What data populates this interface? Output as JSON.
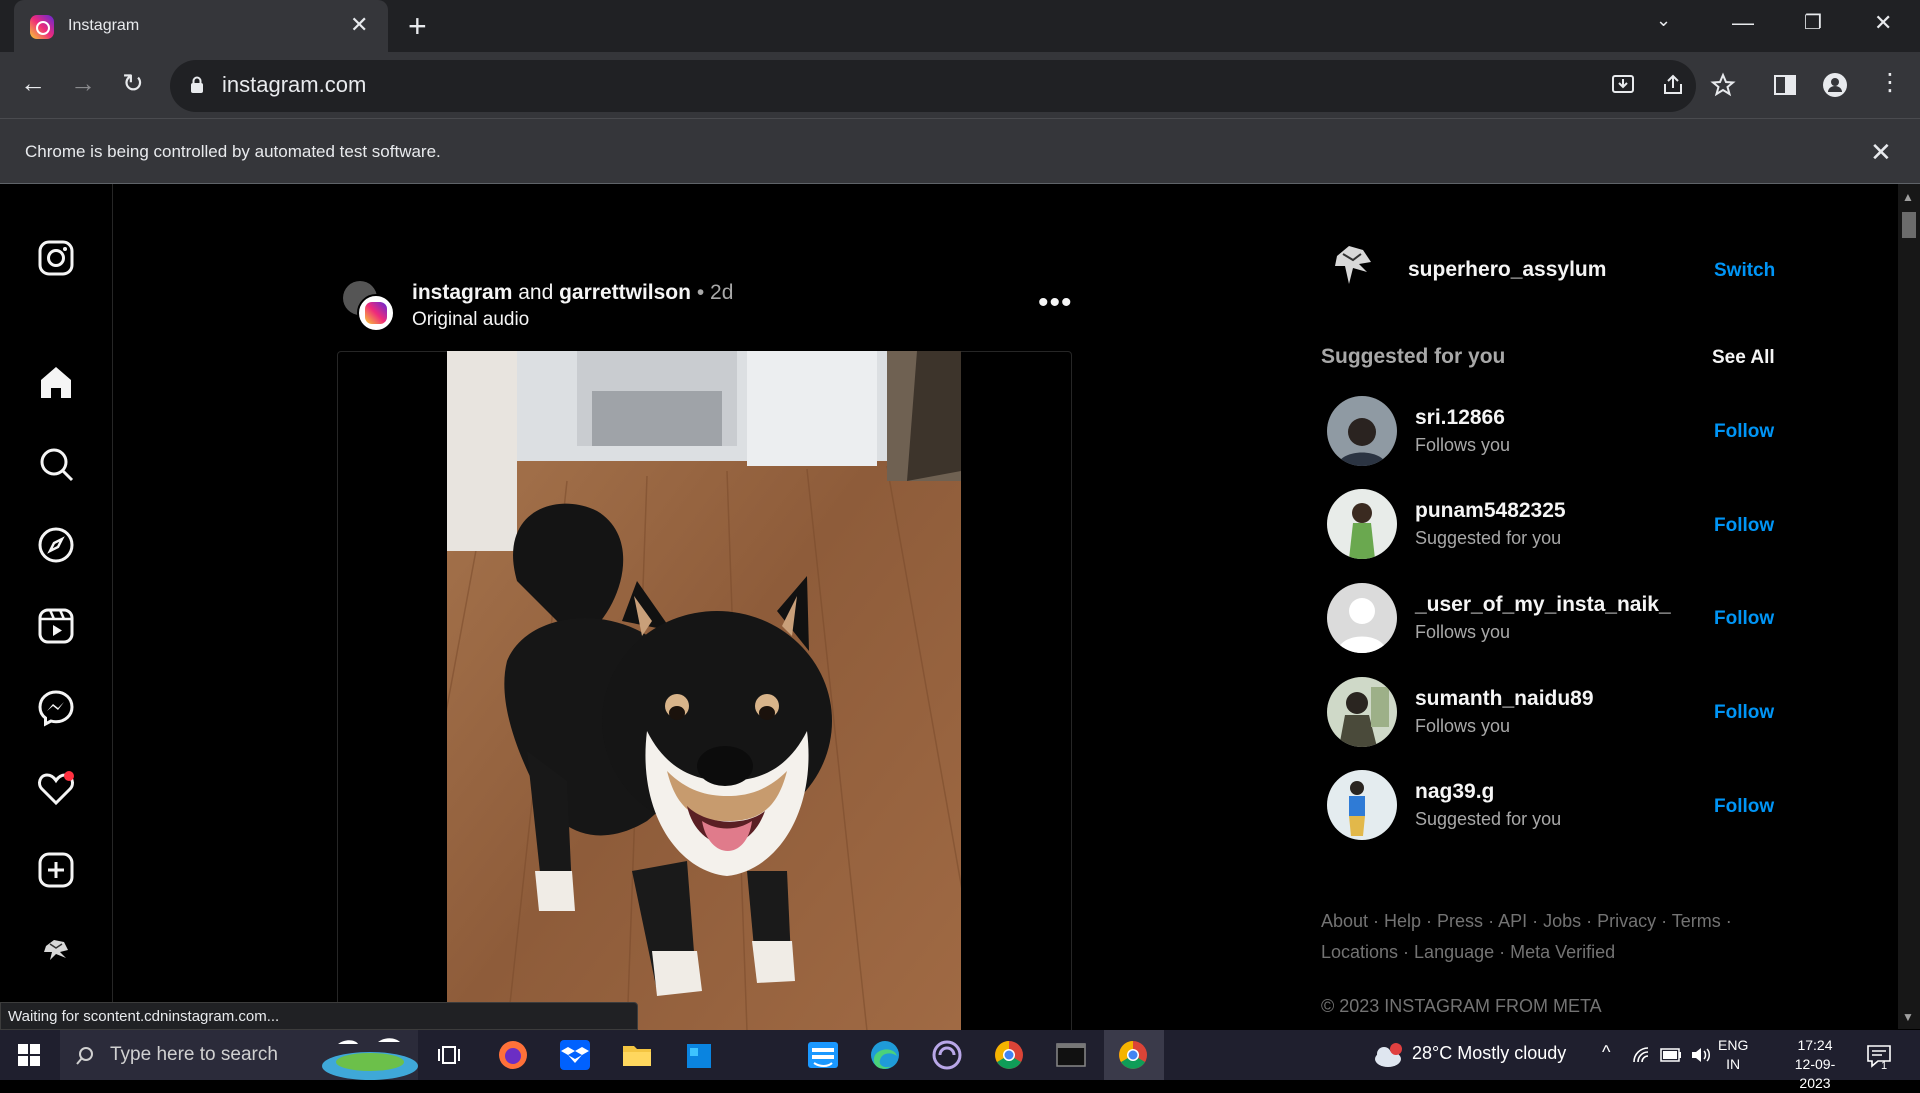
{
  "browser": {
    "tab_title": "Instagram",
    "url": "instagram.com",
    "infobar_text": "Chrome is being controlled by automated test software.",
    "status_text": "Waiting for scontent.cdninstagram.com..."
  },
  "post": {
    "author_primary": "instagram",
    "author_connector": "and",
    "author_secondary": "garrettwilson",
    "separator": "•",
    "time_ago": "2d",
    "audio": "Original audio"
  },
  "sidebar": {
    "username": "superhero_assylum",
    "switch_label": "Switch",
    "suggested_title": "Suggested for you",
    "see_all_label": "See All",
    "suggestions": [
      {
        "name": "sri.12866",
        "subtitle": "Follows you",
        "action": "Follow"
      },
      {
        "name": "punam5482325",
        "subtitle": "Suggested for you",
        "action": "Follow"
      },
      {
        "name": "_user_of_my_insta_naik_",
        "subtitle": "Follows you",
        "action": "Follow"
      },
      {
        "name": "sumanth_naidu89",
        "subtitle": "Follows you",
        "action": "Follow"
      },
      {
        "name": "nag39.g",
        "subtitle": "Suggested for you",
        "action": "Follow"
      }
    ],
    "footer_line1": "About · Help · Press · API · Jobs · Privacy · Terms ·",
    "footer_line2": "Locations · Language · Meta Verified",
    "copyright": "© 2023 INSTAGRAM FROM META"
  },
  "taskbar": {
    "search_placeholder": "Type here to search",
    "weather": "28°C  Mostly cloudy",
    "lang_line1": "ENG",
    "lang_line2": "IN",
    "time": "17:24",
    "date": "12-09-2023",
    "notification_count": "1"
  },
  "colors": {
    "accent": "#0095f6",
    "notification_dot": "#ff3040",
    "muted_text": "#a8a8a8"
  }
}
